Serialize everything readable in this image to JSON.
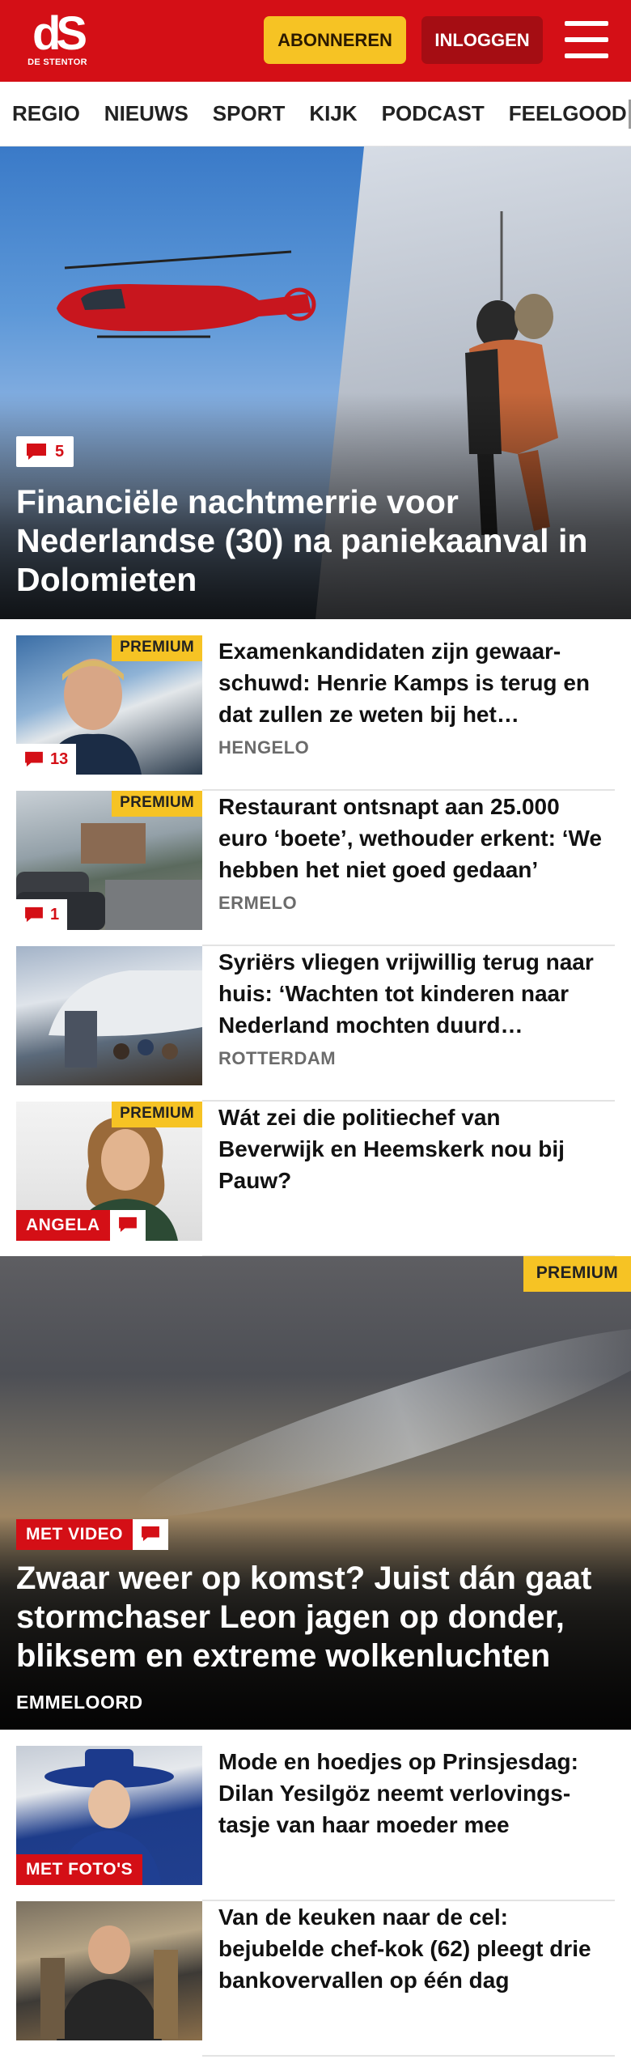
{
  "header": {
    "logo_mark": "dS",
    "logo_text": "DE STENTOR",
    "subscribe_label": "ABONNEREN",
    "login_label": "INLOGGEN"
  },
  "nav": {
    "items": [
      "REGIO",
      "NIEUWS",
      "SPORT",
      "KIJK",
      "PODCAST",
      "FEELGOOD"
    ]
  },
  "hero": {
    "comments": "5",
    "title": "Financiële nachtmerrie voor Nederlandse (30) na paniekaanval in Dolomieten"
  },
  "articles": [
    {
      "premium": "PREMIUM",
      "comments": "13",
      "title": "Examenkandidaten zijn gewaar­schuwd: Henrie Kamps is terug en dat zullen ze weten bij het…",
      "location": "HENGELO"
    },
    {
      "premium": "PREMIUM",
      "comments": "1",
      "title": "Restaurant ontsnapt aan 25.000 euro ‘boete’, wethouder erkent: ‘We hebben het niet goed gedaan’",
      "location": "ERMELO"
    },
    {
      "title": "Syriërs vliegen vrijwillig terug naar huis: ‘Wachten tot kinderen naar Nederland mochten duurd…",
      "location": "ROTTERDAM"
    },
    {
      "premium": "PREMIUM",
      "tag": "ANGELA",
      "title": "Wát zei die politiechef van Beverwijk en Heemskerk nou bij Pauw?"
    }
  ],
  "feature": {
    "premium": "PREMIUM",
    "tag": "MET VIDEO",
    "title": "Zwaar weer op komst? Juist dán gaat stormchaser Leon jagen op donder, bliksem en extreme wolkenluchten",
    "location": "EMMELOORD"
  },
  "articles2": [
    {
      "tag": "MET FOTO'S",
      "title": "Mode en hoedjes op Prinsjesdag: Dilan Yesilgöz neemt verlovings­tasje van haar moeder mee"
    },
    {
      "title": "Van de keuken naar de cel: bejubelde chef-kok (62) pleegt drie bankovervallen op één dag"
    }
  ],
  "colors": {
    "brand_red": "#d40f16",
    "premium_yellow": "#f6c324",
    "login_dark_red": "#a50d13"
  }
}
